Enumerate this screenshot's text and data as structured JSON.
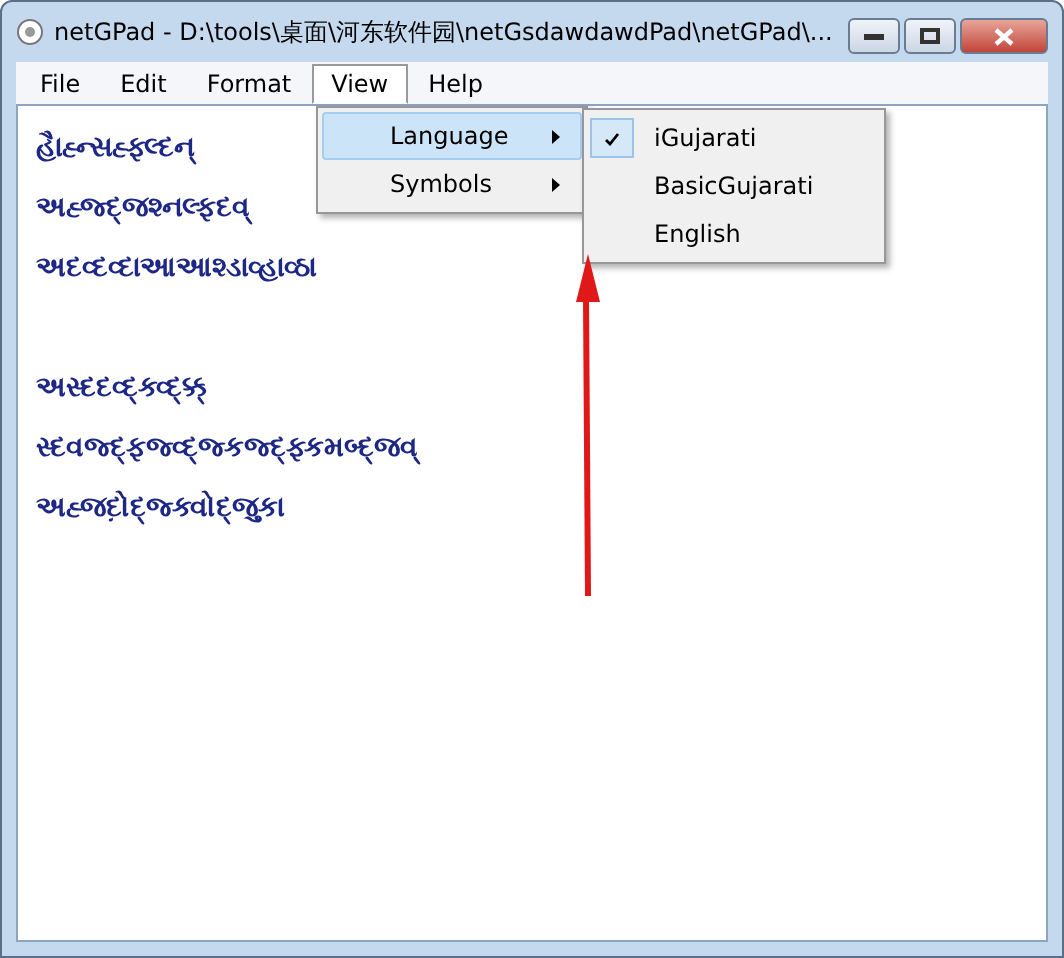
{
  "window": {
    "title": "netGPad - D:\\tools\\桌面\\河东软件园\\netGsdawdawdPad\\netGPad\\..."
  },
  "menu_bar": [
    {
      "label": "File",
      "selected": false
    },
    {
      "label": "Edit",
      "selected": false
    },
    {
      "label": "Format",
      "selected": false
    },
    {
      "label": "View",
      "selected": true
    },
    {
      "label": "Help",
      "selected": false
    }
  ],
  "view_menu": [
    {
      "label": "Language",
      "selected": true,
      "submenu": true
    },
    {
      "label": "Symbols",
      "selected": false,
      "submenu": true
    }
  ],
  "language_submenu": [
    {
      "label": "iGujarati",
      "checked": true
    },
    {
      "label": "BasicGujarati",
      "checked": false
    },
    {
      "label": "English",
      "checked": false
    }
  ],
  "document_lines": [
    {
      "kind": "text",
      "text": "હૈાહ્ન્સહ્ફ્લ્દન્"
    },
    {
      "kind": "text",
      "text": "અહ્જ્દ્જશ્નલ્ફદવ્"
    },
    {
      "kind": "text",
      "text": "અદવ્દવ્દાઆઆશ્ડાવ્હાવ્ઠા"
    },
    {
      "kind": "blank"
    },
    {
      "kind": "text",
      "text": "અસ્દદવ્દ્ક્વ્દ્ક્ક્"
    },
    {
      "kind": "text",
      "text": "સ્દવજ્દ્ફજ્વ્દ્જ્કજ્દ્ફ્કમબ્દ્જવ્"
    },
    {
      "kind": "text",
      "text": "અહ્જદો઼દ્જ્ક્વોદ્જુકા"
    }
  ]
}
